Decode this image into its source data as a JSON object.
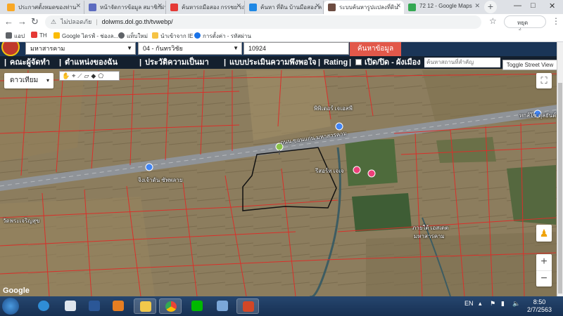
{
  "browser": {
    "tabs": [
      {
        "label": "ประกาศตั้งหมดของท่าน",
        "color": "#f9a825"
      },
      {
        "label": "หน้าจัดการข้อมูล สมาชิกผ่า",
        "color": "#5c6bc0"
      },
      {
        "label": "ค้นหารถมือสอง กรรชย รถ",
        "color": "#e53935"
      },
      {
        "label": "ค้นหา ที่ดิน บ้านมือสอง ค",
        "color": "#1e88e5"
      },
      {
        "label": "ระบบค้นหารูปแปลงที่ดิน",
        "color": "#6d4c41"
      },
      {
        "label": "72 12 - Google Maps",
        "color": "#34a853"
      }
    ],
    "new_tab": "+",
    "window_controls": [
      "—",
      "□",
      "✕"
    ],
    "url_warning": "ไม่ปลอดภัย",
    "url": "dolwms.dol.go.th/tvwebp/",
    "profile": "หยุดชั่วคราว",
    "bookmarks": [
      {
        "label": "แอป",
        "color": "#5f6368"
      },
      {
        "label": "TH",
        "color": "#e53935"
      },
      {
        "label": "Google ไดรฟ์ - ช่องล...",
        "color": "#fbbc04"
      },
      {
        "label": "แท็บใหม่",
        "color": "#5f6368"
      },
      {
        "label": "นำเข้าจาก IE",
        "color": "#f6c344"
      },
      {
        "label": "การตั้งค่า - รหัสผ่าน",
        "color": "#1a73e8"
      }
    ]
  },
  "page": {
    "search": {
      "province": "มหาสารคาม",
      "district": "04 - กันทรวิชัย",
      "parcel_no": "10924",
      "find_button": "ค้นหาข้อมูล"
    },
    "menu": [
      "คณะผู้จัดทำ",
      "ตำแหน่งของฉัน",
      "ประวัติความเป็นมา",
      "แบบประเมินความพึงพอใจ",
      "Rating",
      "เปิด/ปิด - ผังเมือง"
    ],
    "place_search_placeholder": "ค้นหาสถานที่สำคัญ",
    "toggle_street_view": "Toggle Street View",
    "map_type": "ดาวเทียม",
    "draw_tools": "✋⌖⟋▱◆⬠",
    "map_labels": [
      "พิพิเดอร์ เจเอสพี",
      "ถนน ขอนแก่น มหาสารคาม",
      "จิงเจ้าดัน ซัพพลาย",
      "รีสอร์ท เจเจ",
      "หกส์โช ดุลยันต์",
      "ภายใต้ เอสเตต",
      "มหาสารคาม",
      "วัดพระเจริญสุข"
    ],
    "google": "Google"
  },
  "taskbar": {
    "language": "EN",
    "time": "8:50",
    "date": "2/7/2563"
  }
}
